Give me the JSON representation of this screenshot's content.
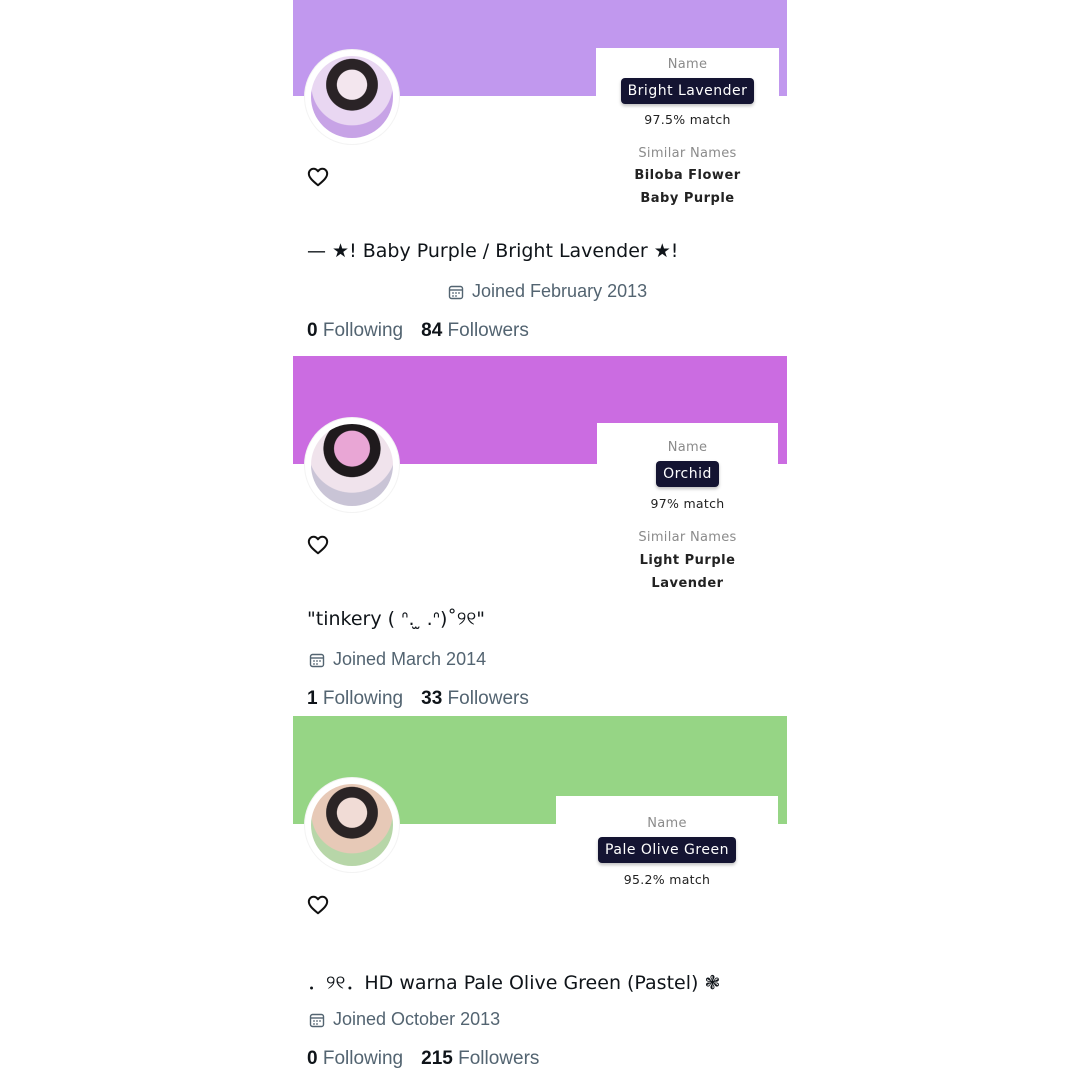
{
  "profiles": [
    {
      "banner_color": "#c198ee",
      "bio": "— ★! Baby Purple / Bright Lavender ★!",
      "joined": "Joined February 2013",
      "following_count": "0",
      "following_label": "Following",
      "followers_count": "84",
      "followers_label": "Followers",
      "color_card": {
        "name_label": "Name",
        "name": "Bright Lavender",
        "match": "97.5% match",
        "similar_label": "Similar Names",
        "similar": [
          "Biloba Flower",
          "Baby Purple"
        ]
      }
    },
    {
      "banner_color": "#cb6ce1",
      "bio": "\"tinkery ( ᐢ. ̫ .ᐢ)˚୨୧\"",
      "joined": "Joined March 2014",
      "following_count": "1",
      "following_label": "Following",
      "followers_count": "33",
      "followers_label": "Followers",
      "color_card": {
        "name_label": "Name",
        "name": "Orchid",
        "match": "97% match",
        "similar_label": "Similar Names",
        "similar": [
          "Light Purple",
          "Lavender"
        ]
      }
    },
    {
      "banner_color": "#96d585",
      "bio": "．୨୧．HD warna Pale Olive Green (Pastel) ❃",
      "joined": "Joined October 2013",
      "following_count": "0",
      "following_label": "Following",
      "followers_count": "215",
      "followers_label": "Followers",
      "color_card": {
        "name_label": "Name",
        "name": "Pale Olive Green",
        "match": "95.2% match"
      }
    }
  ],
  "icons": {
    "heart": "heart-outline-icon",
    "calendar": "calendar-icon"
  }
}
